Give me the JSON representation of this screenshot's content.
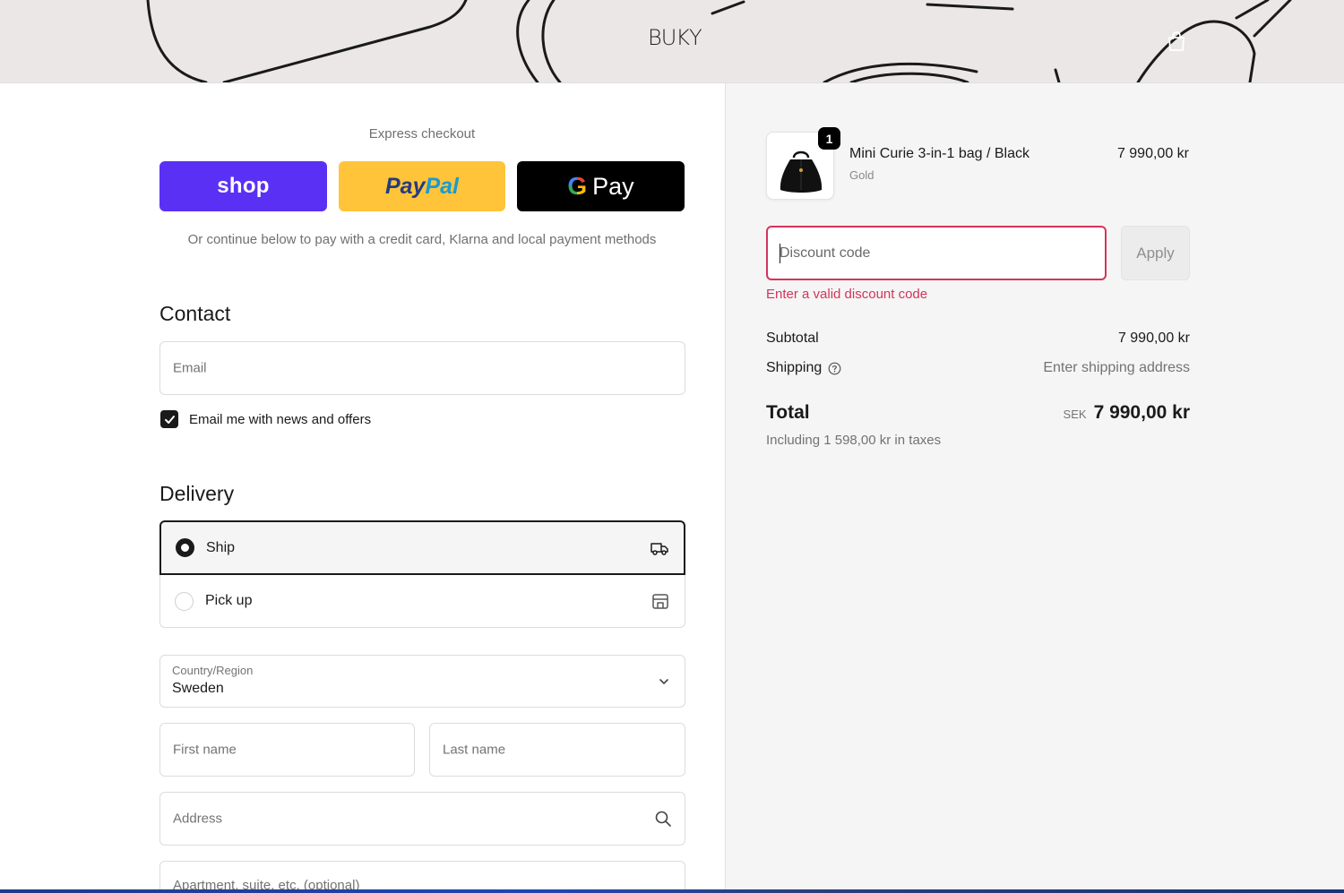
{
  "header": {
    "logo": "BUKY"
  },
  "express": {
    "label": "Express checkout",
    "shop_label": "shop",
    "paypal_label_1": "Pay",
    "paypal_label_2": "Pal",
    "gpay_g": "G",
    "gpay_label": "Pay",
    "continue_text": "Or continue below to pay with a credit card, Klarna and local payment methods"
  },
  "contact": {
    "heading": "Contact",
    "email_placeholder": "Email",
    "newsletter_label": "Email me with news and offers",
    "newsletter_checked": true
  },
  "delivery": {
    "heading": "Delivery",
    "options": [
      {
        "label": "Ship",
        "selected": true,
        "icon": "truck-icon"
      },
      {
        "label": "Pick up",
        "selected": false,
        "icon": "store-icon"
      }
    ],
    "country_label": "Country/Region",
    "country_value": "Sweden",
    "first_name_placeholder": "First name",
    "last_name_placeholder": "Last name",
    "address_placeholder": "Address",
    "apartment_placeholder": "Apartment, suite, etc. (optional)"
  },
  "summary": {
    "item": {
      "quantity": "1",
      "name": "Mini Curie 3-in-1 bag / Black",
      "variant": "Gold",
      "price": "7 990,00 kr"
    },
    "discount_placeholder": "Discount code",
    "apply_label": "Apply",
    "discount_error": "Enter a valid discount code",
    "subtotal_label": "Subtotal",
    "subtotal_value": "7 990,00 kr",
    "shipping_label": "Shipping",
    "shipping_value": "Enter shipping address",
    "total_label": "Total",
    "total_currency": "SEK",
    "total_value": "7 990,00 kr",
    "tax_note": "Including 1 598,00 kr in taxes"
  },
  "colors": {
    "shop_purple": "#5a31f4",
    "paypal_yellow": "#ffc439",
    "error_red": "#d3345a",
    "summary_bg": "#f5f5f5"
  }
}
